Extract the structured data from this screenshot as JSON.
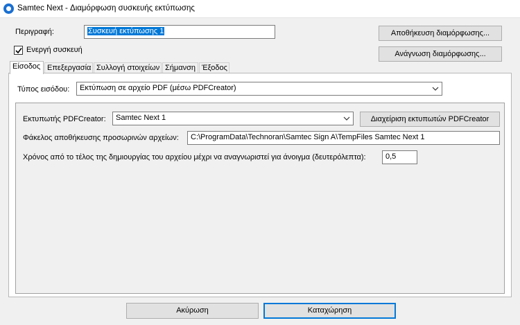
{
  "window": {
    "title": "Samtec Next - Διαμόρφωση συσκευής εκτύπωσης"
  },
  "form": {
    "description_label": "Περιγραφή:",
    "description_value": "Συσκευή εκτύπωσης 1",
    "active_device_label": "Ενεργή συσκευή",
    "active_device_checked": true,
    "save_config_label": "Αποθήκευση διαμόρφωσης...",
    "load_config_label": "Ανάγνωση διαμόρφωσης..."
  },
  "tabs": [
    {
      "label": "Είσοδος",
      "active": true
    },
    {
      "label": "Επεξεργασία",
      "active": false
    },
    {
      "label": "Συλλογή στοιχείων",
      "active": false
    },
    {
      "label": "Σήμανση",
      "active": false
    },
    {
      "label": "Έξοδος",
      "active": false
    }
  ],
  "input_tab": {
    "input_type_label": "Τύπος εισόδου:",
    "input_type_value": "Εκτύπωση σε αρχείο PDF (μέσω PDFCreator)",
    "pdfcreator_printer_label": "Εκτυπωτής PDFCreator:",
    "pdfcreator_printer_value": "Samtec Next 1",
    "manage_printers_label": "Διαχείριση εκτυπωτών PDFCreator",
    "temp_folder_label": "Φάκελος αποθήκευσης προσωρινών αρχείων:",
    "temp_folder_value": "C:\\ProgramData\\Technoran\\Samtec Sign A\\TempFiles Samtec Next 1",
    "wait_time_label": "Χρόνος από το τέλος της δημιουργίας του αρχείου μέχρι να αναγνωριστεί για άνοιγμα (δευτερόλεπτα):",
    "wait_time_value": "0,5"
  },
  "footer": {
    "cancel_label": "Ακύρωση",
    "ok_label": "Καταχώρηση"
  },
  "colors": {
    "window_bg": "#f0f0f0",
    "selection": "#0078d7",
    "app_icon": "#1a6fd1"
  }
}
